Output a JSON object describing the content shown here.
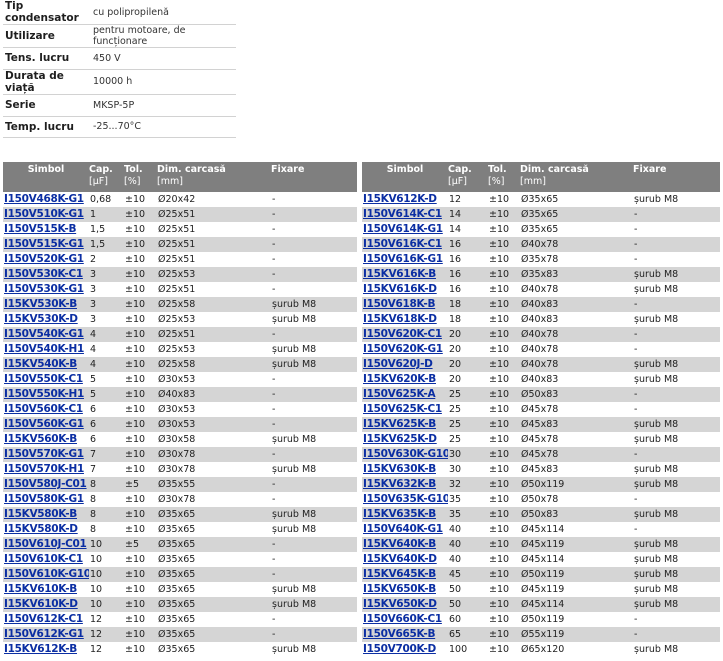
{
  "specs": [
    {
      "label": "Tip condensator",
      "value": "cu polipropilenă"
    },
    {
      "label": "Utilizare",
      "value": "pentru motoare, de funcționare"
    },
    {
      "label": "Tens. lucru",
      "value": "450 V"
    },
    {
      "label": "Durata de viață",
      "value": "10000 h"
    },
    {
      "label": "Serie",
      "value": "MKSP-5P"
    },
    {
      "label": "Temp. lucru",
      "value": "-25...70°C"
    }
  ],
  "columns": [
    {
      "line1": "Simbol",
      "line2": ""
    },
    {
      "line1": "Cap.",
      "line2": "[µF]"
    },
    {
      "line1": "Tol.",
      "line2": "[%]"
    },
    {
      "line1": "Dim. carcasă",
      "line2": "[mm]"
    },
    {
      "line1": "Fixare",
      "line2": ""
    }
  ],
  "tables": [
    [
      [
        "I150V468K-G1",
        "0,68",
        "±10",
        "Ø20x42",
        "-"
      ],
      [
        "I150V510K-G1",
        "1",
        "±10",
        "Ø25x51",
        "-"
      ],
      [
        "I150V515K-B",
        "1,5",
        "±10",
        "Ø25x51",
        "-"
      ],
      [
        "I150V515K-G1",
        "1,5",
        "±10",
        "Ø25x51",
        "-"
      ],
      [
        "I150V520K-G1",
        "2",
        "±10",
        "Ø25x51",
        "-"
      ],
      [
        "I150V530K-C1",
        "3",
        "±10",
        "Ø25x53",
        "-"
      ],
      [
        "I150V530K-G1",
        "3",
        "±10",
        "Ø25x51",
        "-"
      ],
      [
        "I15KV530K-B",
        "3",
        "±10",
        "Ø25x58",
        "șurub M8"
      ],
      [
        "I15KV530K-D",
        "3",
        "±10",
        "Ø25x53",
        "șurub M8"
      ],
      [
        "I150V540K-G1",
        "4",
        "±10",
        "Ø25x51",
        "-"
      ],
      [
        "I150V540K-H1",
        "4",
        "±10",
        "Ø25x53",
        "șurub M8"
      ],
      [
        "I15KV540K-B",
        "4",
        "±10",
        "Ø25x58",
        "șurub M8"
      ],
      [
        "I150V550K-C1",
        "5",
        "±10",
        "Ø30x53",
        "-"
      ],
      [
        "I150V550K-H1",
        "5",
        "±10",
        "Ø40x83",
        "-"
      ],
      [
        "I150V560K-C1",
        "6",
        "±10",
        "Ø30x53",
        "-"
      ],
      [
        "I150V560K-G1",
        "6",
        "±10",
        "Ø30x53",
        "-"
      ],
      [
        "I15KV560K-B",
        "6",
        "±10",
        "Ø30x58",
        "șurub M8"
      ],
      [
        "I150V570K-G1",
        "7",
        "±10",
        "Ø30x78",
        "-"
      ],
      [
        "I150V570K-H1",
        "7",
        "±10",
        "Ø30x78",
        "șurub M8"
      ],
      [
        "I150V580J-C01",
        "8",
        "±5",
        "Ø35x55",
        "-"
      ],
      [
        "I150V580K-G1",
        "8",
        "±10",
        "Ø30x78",
        "-"
      ],
      [
        "I15KV580K-B",
        "8",
        "±10",
        "Ø35x65",
        "șurub M8"
      ],
      [
        "I15KV580K-D",
        "8",
        "±10",
        "Ø35x65",
        "șurub M8"
      ],
      [
        "I150V610J-C01",
        "10",
        "±5",
        "Ø35x65",
        "-"
      ],
      [
        "I150V610K-C1",
        "10",
        "±10",
        "Ø35x65",
        "-"
      ],
      [
        "I150V610K-G10",
        "10",
        "±10",
        "Ø35x65",
        "-"
      ],
      [
        "I15KV610K-B",
        "10",
        "±10",
        "Ø35x65",
        "șurub M8"
      ],
      [
        "I15KV610K-D",
        "10",
        "±10",
        "Ø35x65",
        "șurub M8"
      ],
      [
        "I150V612K-C1",
        "12",
        "±10",
        "Ø35x65",
        "-"
      ],
      [
        "I150V612K-G1",
        "12",
        "±10",
        "Ø35x65",
        "-"
      ],
      [
        "I15KV612K-B",
        "12",
        "±10",
        "Ø35x65",
        "șurub M8"
      ]
    ],
    [
      [
        "I15KV612K-D",
        "12",
        "±10",
        "Ø35x65",
        "șurub M8"
      ],
      [
        "I150V614K-C1",
        "14",
        "±10",
        "Ø35x65",
        "-"
      ],
      [
        "I150V614K-G1",
        "14",
        "±10",
        "Ø35x65",
        "-"
      ],
      [
        "I150V616K-C1",
        "16",
        "±10",
        "Ø40x78",
        "-"
      ],
      [
        "I150V616K-G1",
        "16",
        "±10",
        "Ø35x78",
        "-"
      ],
      [
        "I15KV616K-B",
        "16",
        "±10",
        "Ø35x83",
        "șurub M8"
      ],
      [
        "I15KV616K-D",
        "16",
        "±10",
        "Ø40x78",
        "șurub M8"
      ],
      [
        "I150V618K-B",
        "18",
        "±10",
        "Ø40x83",
        "-"
      ],
      [
        "I15KV618K-D",
        "18",
        "±10",
        "Ø40x83",
        "șurub M8"
      ],
      [
        "I150V620K-C1",
        "20",
        "±10",
        "Ø40x78",
        "-"
      ],
      [
        "I150V620K-G1",
        "20",
        "±10",
        "Ø40x78",
        "-"
      ],
      [
        "I150V620J-D",
        "20",
        "±10",
        "Ø40x78",
        "șurub M8"
      ],
      [
        "I15KV620K-B",
        "20",
        "±10",
        "Ø40x83",
        "șurub M8"
      ],
      [
        "I150V625K-A",
        "25",
        "±10",
        "Ø50x83",
        "-"
      ],
      [
        "I150V625K-C1",
        "25",
        "±10",
        "Ø45x78",
        "-"
      ],
      [
        "I15KV625K-B",
        "25",
        "±10",
        "Ø45x83",
        "șurub M8"
      ],
      [
        "I15KV625K-D",
        "25",
        "±10",
        "Ø45x78",
        "șurub M8"
      ],
      [
        "I150V630K-G10",
        "30",
        "±10",
        "Ø45x78",
        "-"
      ],
      [
        "I15KV630K-B",
        "30",
        "±10",
        "Ø45x83",
        "șurub M8"
      ],
      [
        "I15KV632K-B",
        "32",
        "±10",
        "Ø50x119",
        "șurub M8"
      ],
      [
        "I150V635K-G10",
        "35",
        "±10",
        "Ø50x78",
        "-"
      ],
      [
        "I15KV635K-B",
        "35",
        "±10",
        "Ø50x83",
        "șurub M8"
      ],
      [
        "I150V640K-G1",
        "40",
        "±10",
        "Ø45x114",
        "-"
      ],
      [
        "I15KV640K-B",
        "40",
        "±10",
        "Ø45x119",
        "șurub M8"
      ],
      [
        "I15KV640K-D",
        "40",
        "±10",
        "Ø45x114",
        "șurub M8"
      ],
      [
        "I15KV645K-B",
        "45",
        "±10",
        "Ø50x119",
        "șurub M8"
      ],
      [
        "I15KV650K-B",
        "50",
        "±10",
        "Ø45x119",
        "șurub M8"
      ],
      [
        "I15KV650K-D",
        "50",
        "±10",
        "Ø45x114",
        "șurub M8"
      ],
      [
        "I150V660K-C1",
        "60",
        "±10",
        "Ø50x119",
        "-"
      ],
      [
        "I150V665K-B",
        "65",
        "±10",
        "Ø55x119",
        "-"
      ],
      [
        "I150V700K-D",
        "100",
        "±10",
        "Ø65x120",
        "șurub M8"
      ]
    ]
  ]
}
